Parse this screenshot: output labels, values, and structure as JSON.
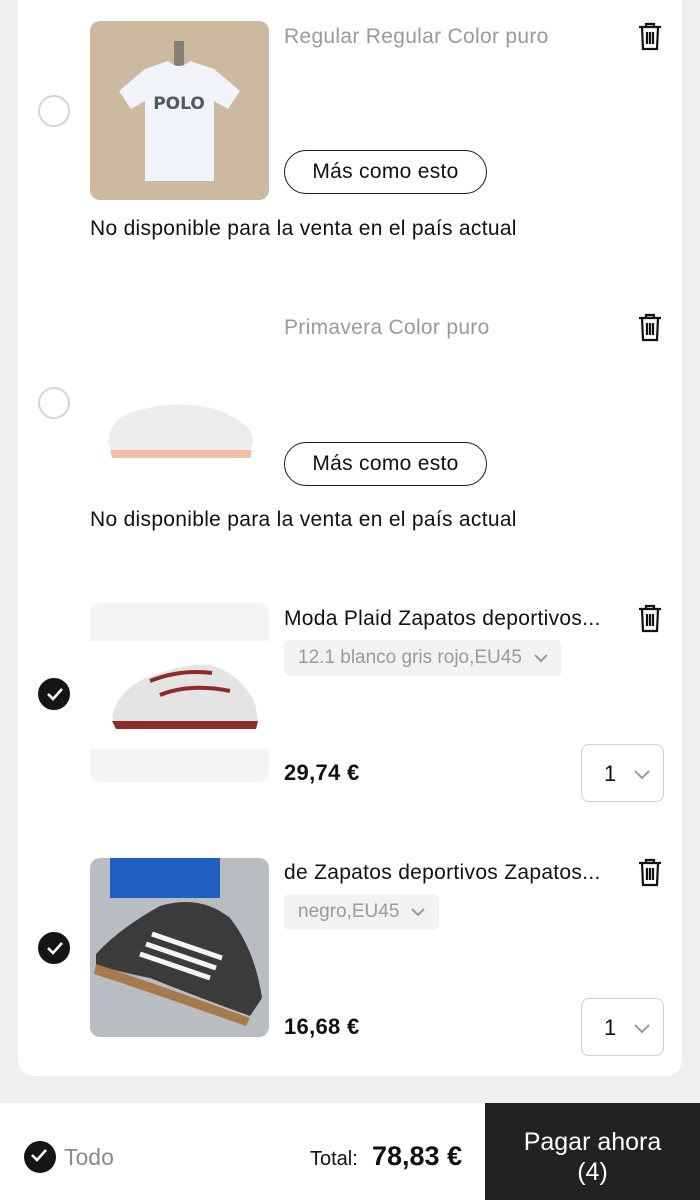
{
  "cart": {
    "items": [
      {
        "title": "Regular Regular Color puro",
        "more_button": "Más como esto",
        "status": "No disponible para la venta en el país actual",
        "image_icon": "polo-tshirt-image"
      },
      {
        "title": "Primavera Color puro",
        "more_button": "Más como esto",
        "status": "No disponible para la venta en el país actual",
        "image_icon": "white-slide-shoe-image"
      },
      {
        "title": "Moda Plaid Zapatos deportivos...",
        "variant": "12.1 blanco gris rojo,EU45",
        "price": "29,74 €",
        "quantity": "1",
        "checked": true,
        "image_icon": "running-sneaker-image"
      },
      {
        "title": "de Zapatos deportivos Zapatos...",
        "variant": "negro,EU45",
        "price": "16,68 €",
        "quantity": "1",
        "checked": true,
        "image_icon": "black-sneaker-image"
      }
    ]
  },
  "footer": {
    "select_all_label": "Todo",
    "total_label": "Total:",
    "total_value": "78,83 €",
    "pay_button_line1": "Pagar ahora",
    "pay_button_line2": "(4)"
  },
  "colors": {
    "accent_dark": "#151515",
    "muted_text": "#9a9a9a",
    "pay_button_bg": "#222222"
  }
}
